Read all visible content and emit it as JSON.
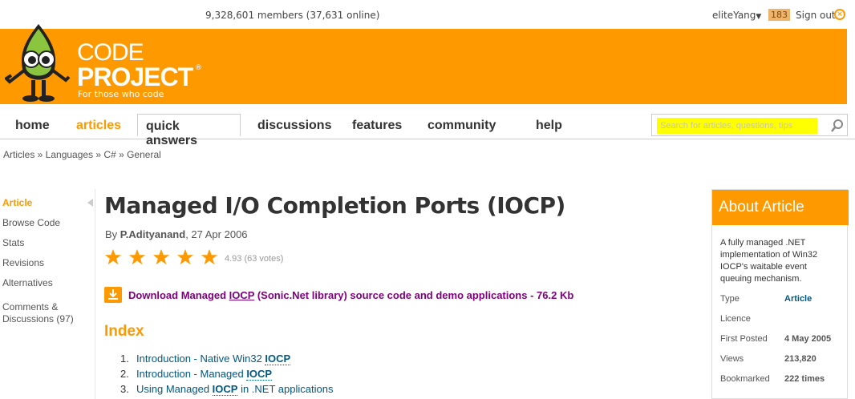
{
  "topbar": {
    "members": "9,328,601 members (37,631 online)",
    "username": "eliteYang",
    "dropdown_glyph": "▼",
    "reputation": "183",
    "signout": "Sign out",
    "signout_icon": "×"
  },
  "logo": {
    "line1": "CODE",
    "line2": "PROJECT",
    "registered": "®",
    "tagline": "For those who code"
  },
  "nav": {
    "tabs": [
      {
        "label": "home"
      },
      {
        "label": "articles"
      },
      {
        "label": "quick answers"
      },
      {
        "label": "discussions"
      },
      {
        "label": "features"
      },
      {
        "label": "community"
      },
      {
        "label": "help"
      }
    ],
    "search_placeholder": "Search for articles, questions, tips"
  },
  "breadcrumb": "Articles » Languages » C# » General",
  "sidenav": {
    "items": [
      {
        "label": "Article"
      },
      {
        "label": "Browse Code"
      },
      {
        "label": "Stats"
      },
      {
        "label": "Revisions"
      },
      {
        "label": "Alternatives"
      },
      {
        "label": "Comments &"
      },
      {
        "label": "Discussions (97)"
      }
    ]
  },
  "article": {
    "title": "Managed I/O Completion Ports (IOCP)",
    "by": "By",
    "author": "P.Adityanand",
    "date": ", 27 Apr 2006",
    "rating": 4.93,
    "rating_text": "4.93 (63 votes)",
    "download_pre": "Download Managed ",
    "download_kw": "IOCP",
    "download_post": " (Sonic.Net library) source code and demo applications - 76.2 Kb",
    "index_heading": "Index",
    "index": [
      {
        "num": "1.",
        "pre": "Introduction - Native Win32 ",
        "kw": "IOCP",
        "post": ""
      },
      {
        "num": "2.",
        "pre": "Introduction - Managed ",
        "kw": "IOCP",
        "post": ""
      },
      {
        "num": "3.",
        "pre": "Using Managed ",
        "kw": "IOCP",
        "post": " in .NET applications"
      }
    ]
  },
  "about": {
    "heading": "About Article",
    "description": "A fully managed .NET implementation of Win32 IOCP's waitable event queuing mechanism.",
    "rows": [
      {
        "key": "Type",
        "value": "Article"
      },
      {
        "key": "Licence",
        "value": ""
      },
      {
        "key": "First Posted",
        "value": "4 May 2005"
      },
      {
        "key": "Views",
        "value": "213,820"
      },
      {
        "key": "Bookmarked",
        "value": "222 times"
      }
    ]
  },
  "colors": {
    "brand_orange": "#ff9900",
    "link_blue": "#005782",
    "download_purple": "#800080",
    "search_highlight": "#ffff00"
  }
}
